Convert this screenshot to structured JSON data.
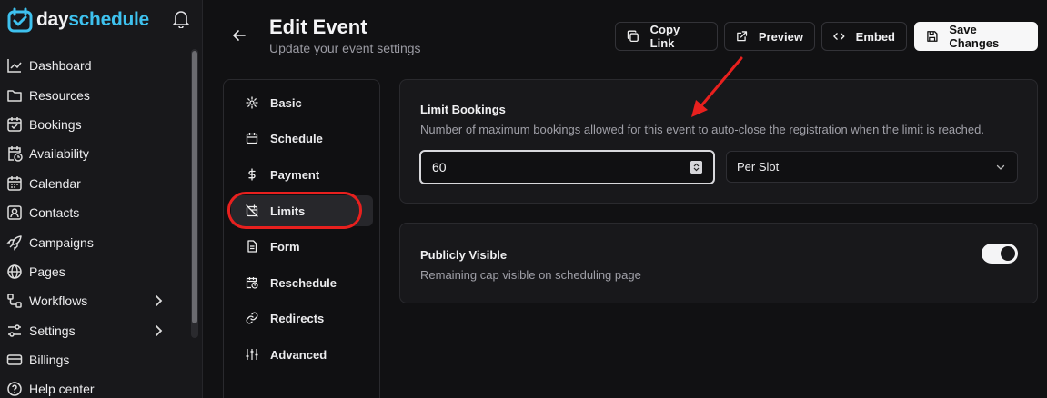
{
  "brand": {
    "part1": "day",
    "part2": "schedule"
  },
  "sidebar": {
    "items": [
      {
        "label": "Dashboard",
        "icon": "chart-line-icon"
      },
      {
        "label": "Resources",
        "icon": "folder-icon"
      },
      {
        "label": "Bookings",
        "icon": "calendar-check-icon"
      },
      {
        "label": "Availability",
        "icon": "calendar-clock-icon"
      },
      {
        "label": "Calendar",
        "icon": "calendar-icon"
      },
      {
        "label": "Contacts",
        "icon": "contact-icon"
      },
      {
        "label": "Campaigns",
        "icon": "rocket-icon"
      },
      {
        "label": "Pages",
        "icon": "globe-icon"
      },
      {
        "label": "Workflows",
        "icon": "workflow-icon"
      },
      {
        "label": "Settings",
        "icon": "sliders-icon"
      },
      {
        "label": "Billings",
        "icon": "credit-card-icon"
      },
      {
        "label": "Help center",
        "icon": "help-icon"
      }
    ]
  },
  "header": {
    "title": "Edit Event",
    "subtitle": "Update your event settings",
    "buttons": {
      "copy_link": "Copy Link",
      "preview": "Preview",
      "embed": "Embed",
      "save": "Save Changes"
    }
  },
  "tabs": [
    {
      "label": "Basic",
      "icon": "gear-icon"
    },
    {
      "label": "Schedule",
      "icon": "calendar-icon"
    },
    {
      "label": "Payment",
      "icon": "dollar-icon"
    },
    {
      "label": "Limits",
      "icon": "calendar-off-icon",
      "active": true
    },
    {
      "label": "Form",
      "icon": "file-text-icon"
    },
    {
      "label": "Reschedule",
      "icon": "calendar-clock-icon"
    },
    {
      "label": "Redirects",
      "icon": "link-icon"
    },
    {
      "label": "Advanced",
      "icon": "sliders-icon"
    }
  ],
  "limit_bookings": {
    "title": "Limit Bookings",
    "description": "Number of maximum bookings allowed for this event to auto-close the registration when the limit is reached.",
    "value": "60",
    "per": "Per Slot"
  },
  "public": {
    "title": "Publicly Visible",
    "description": "Remaining cap visible on scheduling page",
    "enabled": true
  },
  "colors": {
    "accent": "#3ec1ee",
    "annotation": "#e8201e",
    "background": "#111113"
  }
}
